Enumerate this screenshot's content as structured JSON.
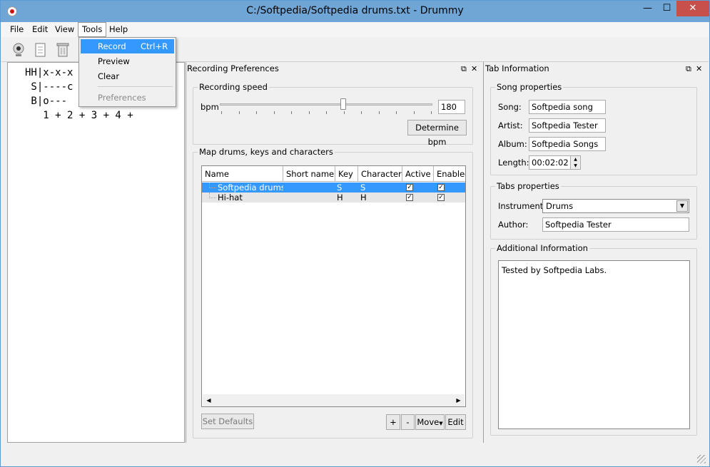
{
  "window": {
    "title": "C:/Softpedia/Softpedia drums.txt - Drummy",
    "min_glyph": "—",
    "max_glyph": "☐",
    "close_glyph": "✕"
  },
  "menu": {
    "items": [
      "File",
      "Edit",
      "View",
      "Tools",
      "Help"
    ],
    "open": "Tools"
  },
  "tools_menu": {
    "record": "Record",
    "record_shortcut": "Ctrl+R",
    "preview": "Preview",
    "clear": "Clear",
    "preferences": "Preferences"
  },
  "toolbar": {
    "icons": [
      "webcam-icon",
      "document-icon",
      "recycle-bin-icon"
    ]
  },
  "editor": {
    "lines": [
      "HH|x-x-x",
      " S|----c",
      " B|o---",
      "   1 + 2 + 3 + 4 +"
    ]
  },
  "recording_prefs": {
    "header": "Recording Preferences",
    "speed_group": "Recording speed",
    "bpm_label": "bpm",
    "bpm_value": "180",
    "slider_fraction": 0.58,
    "determine_button": "Determine bpm",
    "map_group": "Map drums, keys and characters",
    "columns": [
      "Name",
      "Short name",
      "Key",
      "Character",
      "Active",
      "Enabled"
    ],
    "rows": [
      {
        "name": "Softpedia drums",
        "short": "",
        "key": "S",
        "char": "S",
        "active": true,
        "enabled": true,
        "selected": true
      },
      {
        "name": "Hi-hat",
        "short": "",
        "key": "H",
        "char": "H",
        "active": true,
        "enabled": true,
        "selected": false
      }
    ],
    "set_defaults": "Set Defaults",
    "plus": "+",
    "minus": "-",
    "move": "Move",
    "edit": "Edit"
  },
  "tab_info": {
    "header": "Tab Information",
    "song_group": "Song properties",
    "song_label": "Song:",
    "song_value": "Softpedia song",
    "artist_label": "Artist:",
    "artist_value": "Softpedia Tester",
    "album_label": "Album:",
    "album_value": "Softpedia Songs",
    "length_label": "Length:",
    "length_value": "00:02:02",
    "tabs_group": "Tabs properties",
    "instrument_label": "Instrument:",
    "instrument_value": "Drums",
    "author_label": "Author:",
    "author_value": "Softpedia Tester",
    "additional_group": "Additional Information",
    "additional_text": "Tested by Softpedia Labs."
  },
  "colors": {
    "titlebar": "#6fa6d6",
    "selection": "#3399ff",
    "close": "#c7504b"
  }
}
